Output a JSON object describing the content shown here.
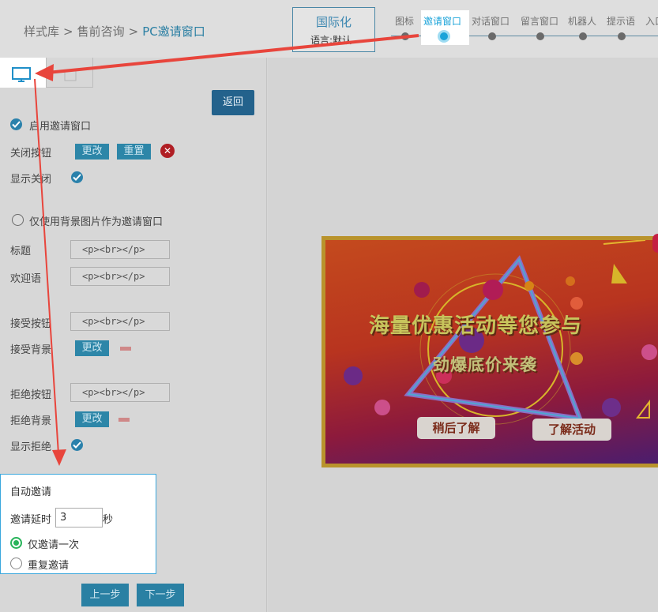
{
  "header": {
    "breadcrumb": [
      "样式库",
      "售前咨询",
      "PC邀请窗口"
    ],
    "breadcrumb_sep": ">",
    "i18n_title": "国际化",
    "i18n_lang": "语言:默认",
    "steps": [
      "图标",
      "邀请窗口",
      "对话窗口",
      "留言窗口",
      "机器人",
      "提示语",
      "入口"
    ],
    "active_step": "邀请窗口"
  },
  "left": {
    "back_label": "返回",
    "enable_invite": "启用邀请窗口",
    "close_button_label": "关闭按钮",
    "change_label": "更改",
    "reset_label": "重置",
    "close_x": "✕",
    "show_close_label": "显示关闭",
    "bg_only_label": "仅使用背景图片作为邀请窗口",
    "title_label": "标题",
    "title_value": "<p><br></p>",
    "welcome_label": "欢迎语",
    "welcome_value": "<p><br></p>",
    "accept_button_label": "接受按钮",
    "accept_button_value": "<p><br></p>",
    "accept_bg_label": "接受背景",
    "accept_bg_change": "更改",
    "reject_button_label": "拒绝按钮",
    "reject_button_value": "<p><br></p>",
    "reject_bg_label": "拒绝背景",
    "reject_bg_change": "更改",
    "show_reject_label": "显示拒绝",
    "auto_invite": {
      "title": "自动邀请",
      "delay_label": "邀请延时",
      "delay_value": "3",
      "delay_unit": "秒",
      "once_label": "仅邀请一次",
      "repeat_label": "重复邀请"
    },
    "prev_label": "上一步",
    "next_label": "下一步"
  },
  "preview": {
    "banner_title": "海量优惠活动等您参与",
    "banner_subtitle": "劲爆底价来袭",
    "later_label": "稍后了解",
    "learn_label": "了解活动"
  },
  "colors": {
    "accent": "#2a80a3",
    "active_step": "#19a3d9",
    "annotation": "#e8453c"
  }
}
